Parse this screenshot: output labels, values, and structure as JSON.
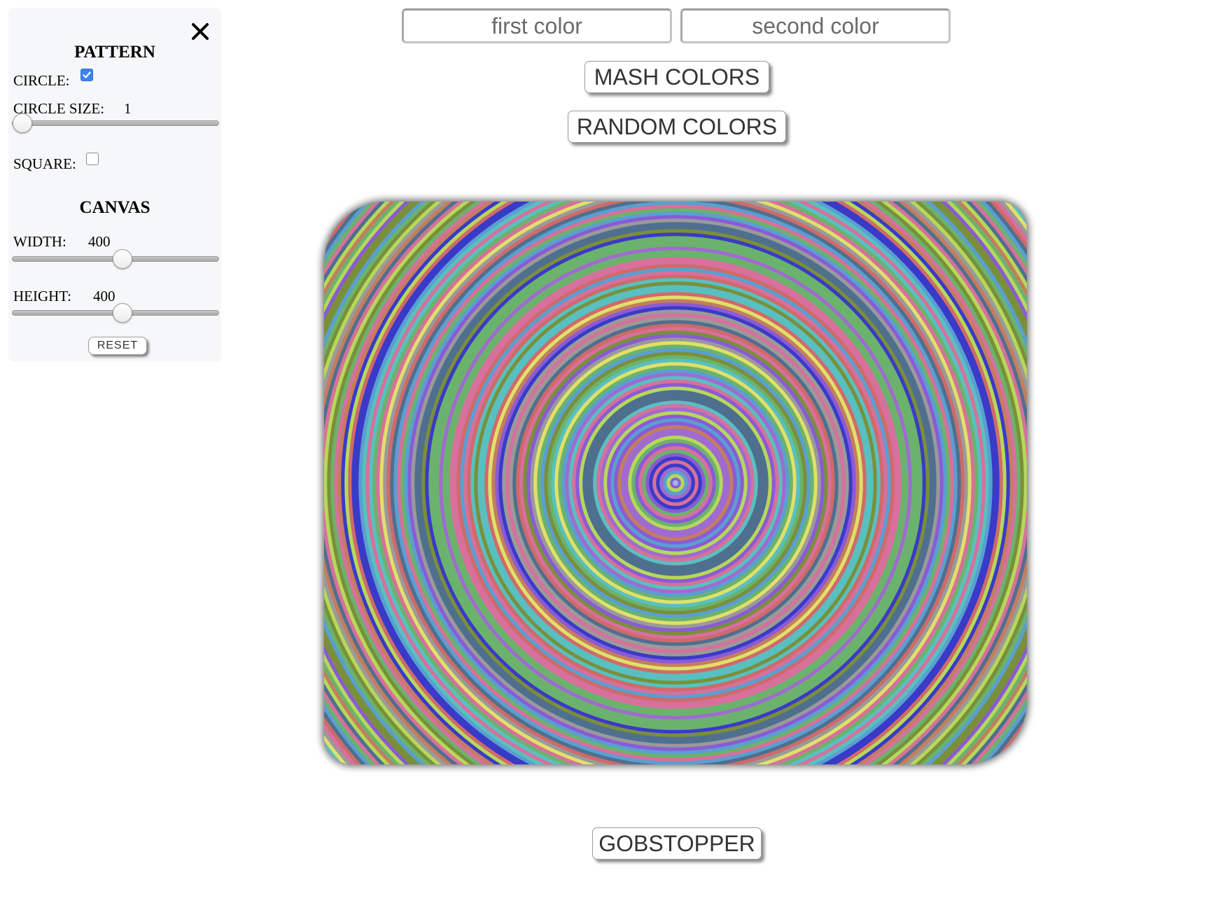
{
  "panel": {
    "close_icon": "close-icon",
    "pattern_title": "PATTERN",
    "circle_label": "CIRCLE:",
    "circle_checked": true,
    "circle_size_label": "CIRCLE SIZE:",
    "circle_size_value": "1",
    "square_label": "SQUARE:",
    "square_checked": false,
    "canvas_title": "CANVAS",
    "width_label": "WIDTH:",
    "width_value": "400",
    "height_label": "HEIGHT:",
    "height_value": "400",
    "reset_label": "RESET"
  },
  "controls": {
    "first_color_placeholder": "first color",
    "second_color_placeholder": "second color",
    "mash_label": "MASH COLORS",
    "random_label": "RANDOM COLORS",
    "gobstopper_label": "GOBSTOPPER"
  },
  "colors": {
    "checkbox_accent": "#3b84f0",
    "canvas_ring_palette": [
      "#8a5bd6",
      "#5a9fd0",
      "#b6d85a",
      "#d7709c",
      "#3a3ac8",
      "#9a9a9a",
      "#6bb36c",
      "#c47d5e",
      "#e0e06a",
      "#4f6f8f",
      "#d06a6a",
      "#a06bd0",
      "#58c0c0",
      "#7a8f3a"
    ]
  }
}
